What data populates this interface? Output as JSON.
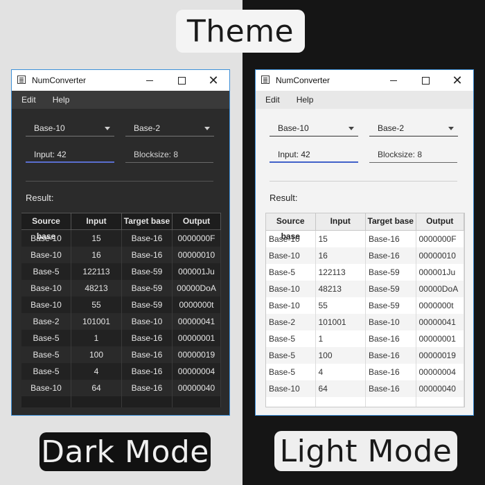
{
  "header": {
    "title": "Theme"
  },
  "labels": {
    "dark": "Dark Mode",
    "light": "Light Mode"
  },
  "app": {
    "title": "NumConverter",
    "menu": [
      "Edit",
      "Help"
    ],
    "source_select": "Base-10",
    "target_select": "Base-2",
    "input_field": "Input: 42",
    "blocksize_field": "Blocksize: 8",
    "result_label": "Result:",
    "table": {
      "headers": [
        "Source base",
        "Input",
        "Target base",
        "Output"
      ],
      "rows": [
        [
          "Base-10",
          "15",
          "Base-16",
          "0000000F"
        ],
        [
          "Base-10",
          "16",
          "Base-16",
          "00000010"
        ],
        [
          "Base-5",
          "122113",
          "Base-59",
          "000001Ju"
        ],
        [
          "Base-10",
          "48213",
          "Base-59",
          "00000DoA"
        ],
        [
          "Base-10",
          "55",
          "Base-59",
          "0000000t"
        ],
        [
          "Base-2",
          "101001",
          "Base-10",
          "00000041"
        ],
        [
          "Base-5",
          "1",
          "Base-16",
          "00000001"
        ],
        [
          "Base-5",
          "100",
          "Base-16",
          "00000019"
        ],
        [
          "Base-5",
          "4",
          "Base-16",
          "00000004"
        ],
        [
          "Base-10",
          "64",
          "Base-16",
          "00000040"
        ]
      ]
    }
  },
  "colors": {
    "dark_window_bg": "#2b2b2b",
    "light_window_bg": "#f3f3f3",
    "window_border": "#3c8fd8",
    "focus_underline": "#4060c8"
  }
}
